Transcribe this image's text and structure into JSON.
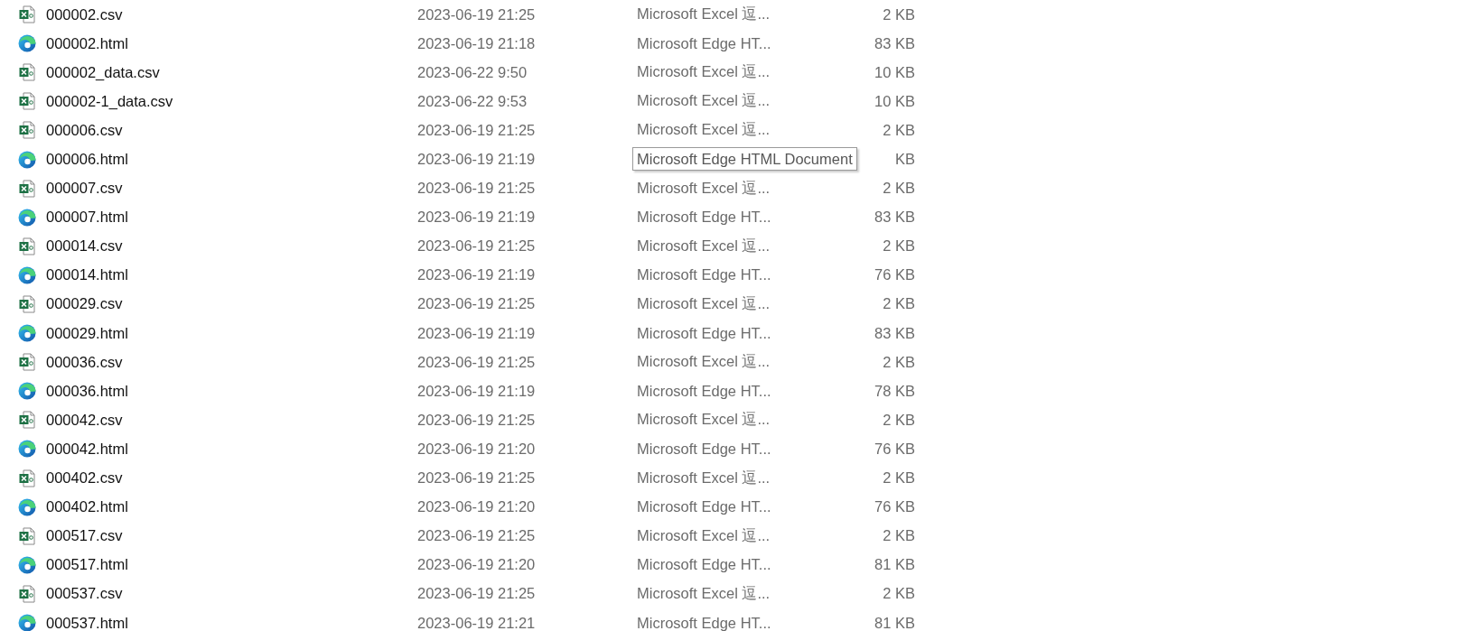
{
  "files": [
    {
      "kind": "sheet",
      "name": "000002.csv",
      "modified": "2023-06-19 21:25",
      "type": "Microsoft Excel 逗...",
      "size": "2 KB"
    },
    {
      "kind": "web",
      "name": "000002.html",
      "modified": "2023-06-19 21:18",
      "type": "Microsoft Edge HT...",
      "size": "83 KB"
    },
    {
      "kind": "sheet",
      "name": "000002_data.csv",
      "modified": "2023-06-22 9:50",
      "type": "Microsoft Excel 逗...",
      "size": "10 KB"
    },
    {
      "kind": "sheet",
      "name": "000002-1_data.csv",
      "modified": "2023-06-22 9:53",
      "type": "Microsoft Excel 逗...",
      "size": "10 KB"
    },
    {
      "kind": "sheet",
      "name": "000006.csv",
      "modified": "2023-06-19 21:25",
      "type": "Microsoft Excel 逗...",
      "size": "2 KB"
    },
    {
      "kind": "web",
      "name": "000006.html",
      "modified": "2023-06-19 21:19",
      "size": "KB",
      "tooltip": "Microsoft Edge HTML Document"
    },
    {
      "kind": "sheet",
      "name": "000007.csv",
      "modified": "2023-06-19 21:25",
      "type": "Microsoft Excel 逗...",
      "size": "2 KB"
    },
    {
      "kind": "web",
      "name": "000007.html",
      "modified": "2023-06-19 21:19",
      "type": "Microsoft Edge HT...",
      "size": "83 KB"
    },
    {
      "kind": "sheet",
      "name": "000014.csv",
      "modified": "2023-06-19 21:25",
      "type": "Microsoft Excel 逗...",
      "size": "2 KB"
    },
    {
      "kind": "web",
      "name": "000014.html",
      "modified": "2023-06-19 21:19",
      "type": "Microsoft Edge HT...",
      "size": "76 KB"
    },
    {
      "kind": "sheet",
      "name": "000029.csv",
      "modified": "2023-06-19 21:25",
      "type": "Microsoft Excel 逗...",
      "size": "2 KB"
    },
    {
      "kind": "web",
      "name": "000029.html",
      "modified": "2023-06-19 21:19",
      "type": "Microsoft Edge HT...",
      "size": "83 KB"
    },
    {
      "kind": "sheet",
      "name": "000036.csv",
      "modified": "2023-06-19 21:25",
      "type": "Microsoft Excel 逗...",
      "size": "2 KB"
    },
    {
      "kind": "web",
      "name": "000036.html",
      "modified": "2023-06-19 21:19",
      "type": "Microsoft Edge HT...",
      "size": "78 KB"
    },
    {
      "kind": "sheet",
      "name": "000042.csv",
      "modified": "2023-06-19 21:25",
      "type": "Microsoft Excel 逗...",
      "size": "2 KB"
    },
    {
      "kind": "web",
      "name": "000042.html",
      "modified": "2023-06-19 21:20",
      "type": "Microsoft Edge HT...",
      "size": "76 KB"
    },
    {
      "kind": "sheet",
      "name": "000402.csv",
      "modified": "2023-06-19 21:25",
      "type": "Microsoft Excel 逗...",
      "size": "2 KB"
    },
    {
      "kind": "web",
      "name": "000402.html",
      "modified": "2023-06-19 21:20",
      "type": "Microsoft Edge HT...",
      "size": "76 KB"
    },
    {
      "kind": "sheet",
      "name": "000517.csv",
      "modified": "2023-06-19 21:25",
      "type": "Microsoft Excel 逗...",
      "size": "2 KB"
    },
    {
      "kind": "web",
      "name": "000517.html",
      "modified": "2023-06-19 21:20",
      "type": "Microsoft Edge HT...",
      "size": "81 KB"
    },
    {
      "kind": "sheet",
      "name": "000537.csv",
      "modified": "2023-06-19 21:25",
      "type": "Microsoft Excel 逗...",
      "size": "2 KB"
    },
    {
      "kind": "web",
      "name": "000537.html",
      "modified": "2023-06-19 21:21",
      "type": "Microsoft Edge HT...",
      "size": "81 KB"
    }
  ]
}
